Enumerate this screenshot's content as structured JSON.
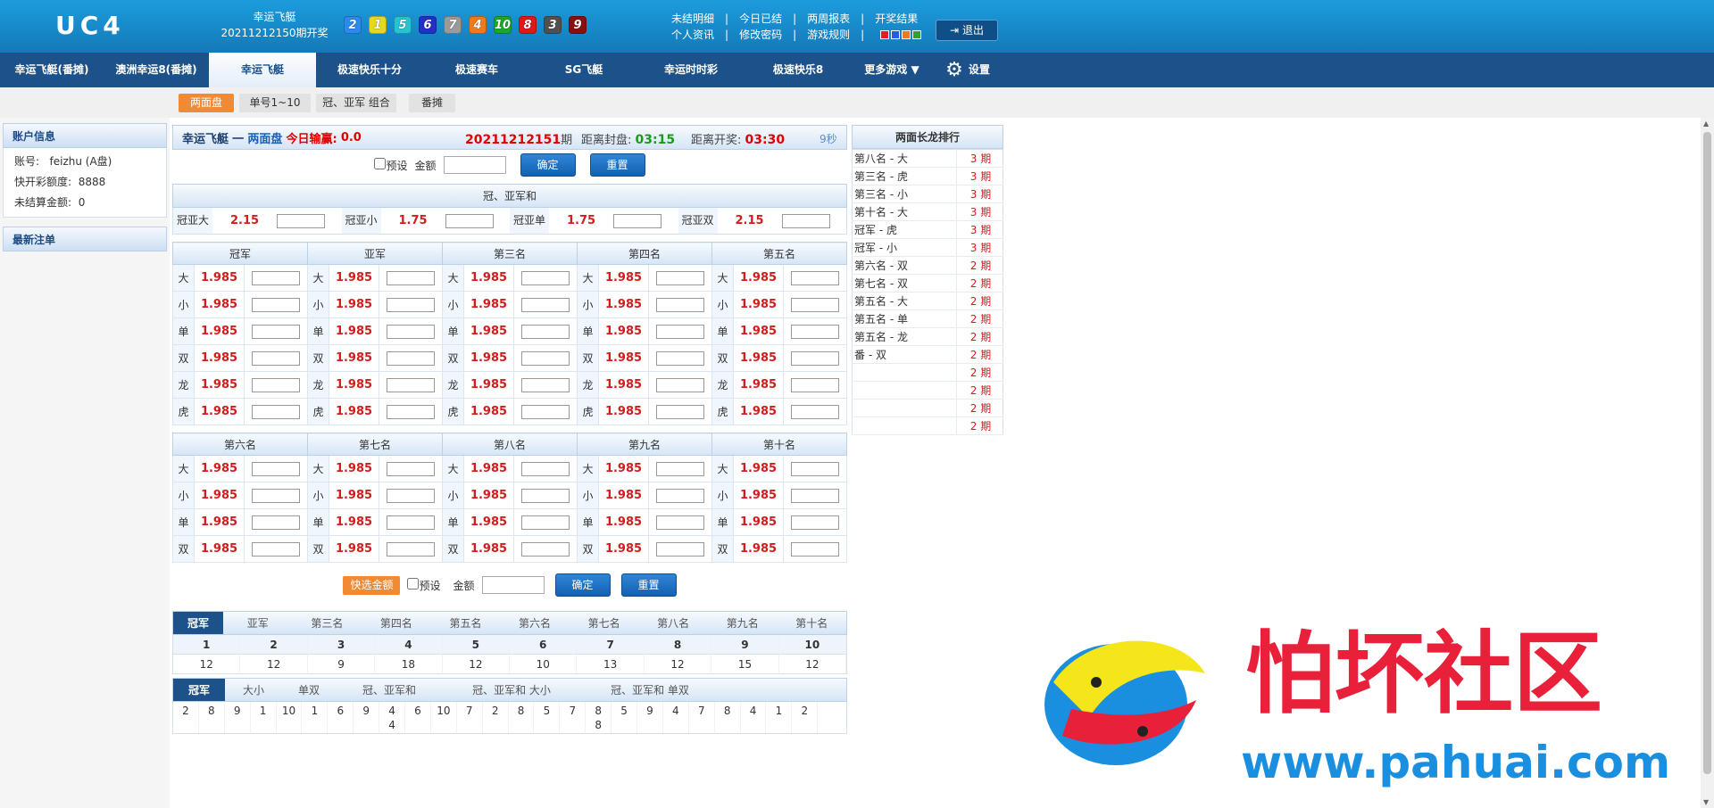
{
  "header": {
    "logo": "UC4",
    "game_name": "幸运飞艇",
    "draw_period": "20211212150期开奖",
    "balls": [
      {
        "n": "2",
        "color": "#2b8af0"
      },
      {
        "n": "1",
        "color": "#e6d820"
      },
      {
        "n": "5",
        "color": "#26c4d2"
      },
      {
        "n": "6",
        "color": "#2030c8"
      },
      {
        "n": "7",
        "color": "#9a9a9a"
      },
      {
        "n": "4",
        "color": "#f07a1a"
      },
      {
        "n": "10",
        "color": "#1aa82a"
      },
      {
        "n": "8",
        "color": "#e01818"
      },
      {
        "n": "3",
        "color": "#505050"
      },
      {
        "n": "9",
        "color": "#8a1010"
      }
    ],
    "links_row1": [
      "未结明细",
      "今日已结",
      "两周报表",
      "开奖结果"
    ],
    "links_row2": [
      "个人资讯",
      "修改密码",
      "游戏规则"
    ],
    "swatches": [
      "#e02020",
      "#2060e0",
      "#f07a1a",
      "#30a030"
    ],
    "logout": "退出"
  },
  "nav": {
    "items": [
      "幸运飞艇(番摊)",
      "澳洲幸运8(番摊)",
      "幸运飞艇",
      "极速快乐十分",
      "极速赛车",
      "SG飞艇",
      "幸运时时彩",
      "极速快乐8",
      "更多游戏 ▼"
    ],
    "settings": "设置"
  },
  "subnav": [
    "两面盘",
    "单号1~10",
    "冠、亚军 组合",
    "番摊"
  ],
  "account": {
    "title": "账户信息",
    "account_label": "账号:",
    "account_value": "feizhu (A盘)",
    "credit_label": "快开彩额度:",
    "credit_value": "8888",
    "unsettled_label": "未结算金额:",
    "unsettled_value": "0",
    "recent_title": "最新注单"
  },
  "titlebar": {
    "game": "幸运飞艇",
    "dash": "一",
    "mode": "两面盘",
    "today_label": "今日输赢:",
    "today_value": "0.0",
    "period": "20211212151",
    "period_suffix": "期",
    "close_label": "距离封盘:",
    "close_time": "03:15",
    "draw_label": "距离开奖:",
    "draw_time": "03:30",
    "refresh": "9秒"
  },
  "betbar": {
    "preset": "预设",
    "amount": "金额",
    "confirm": "确定",
    "reset": "重置",
    "quick": "快选金额"
  },
  "gyh": {
    "title": "冠、亚军和",
    "items": [
      {
        "label": "冠亚大",
        "odds": "2.15"
      },
      {
        "label": "冠亚小",
        "odds": "1.75"
      },
      {
        "label": "冠亚单",
        "odds": "1.75"
      },
      {
        "label": "冠亚双",
        "odds": "2.15"
      }
    ]
  },
  "grid1": {
    "headers": [
      "冠军",
      "亚军",
      "第三名",
      "第四名",
      "第五名"
    ],
    "rows": [
      "大",
      "小",
      "单",
      "双",
      "龙",
      "虎"
    ],
    "odds": "1.985"
  },
  "grid2": {
    "headers": [
      "第六名",
      "第七名",
      "第八名",
      "第九名",
      "第十名"
    ],
    "rows": [
      "大",
      "小",
      "单",
      "双"
    ],
    "odds": "1.985"
  },
  "stats": {
    "tabs": [
      "冠军",
      "亚军",
      "第三名",
      "第四名",
      "第五名",
      "第六名",
      "第七名",
      "第八名",
      "第九名",
      "第十名"
    ],
    "numbers": [
      "1",
      "2",
      "3",
      "4",
      "5",
      "6",
      "7",
      "8",
      "9",
      "10"
    ],
    "counts": [
      "12",
      "12",
      "9",
      "18",
      "12",
      "10",
      "13",
      "12",
      "15",
      "12"
    ]
  },
  "trend": {
    "tabs": [
      "冠军",
      "大小",
      "单双",
      "冠、亚军和",
      "冠、亚军和 大小",
      "冠、亚军和 单双"
    ],
    "values": [
      [
        "2"
      ],
      [
        "8"
      ],
      [
        "9"
      ],
      [
        "1"
      ],
      [
        "10"
      ],
      [
        "1"
      ],
      [
        "6"
      ],
      [
        "9"
      ],
      [
        "4",
        "4"
      ],
      [
        "6"
      ],
      [
        "10"
      ],
      [
        "7"
      ],
      [
        "2"
      ],
      [
        "8"
      ],
      [
        "5"
      ],
      [
        "7"
      ],
      [
        "8",
        "8"
      ],
      [
        "5"
      ],
      [
        "9"
      ],
      [
        "4"
      ],
      [
        "7"
      ],
      [
        "8"
      ],
      [
        "4"
      ],
      [
        "1"
      ],
      [
        "2"
      ]
    ]
  },
  "ranking": {
    "title": "两面长龙排行",
    "rows": [
      {
        "name": "第八名 - 大",
        "count": "3 期"
      },
      {
        "name": "第三名 - 虎",
        "count": "3 期"
      },
      {
        "name": "第三名 - 小",
        "count": "3 期"
      },
      {
        "name": "第十名 - 大",
        "count": "3 期"
      },
      {
        "name": "冠军 - 虎",
        "count": "3 期"
      },
      {
        "name": "冠军 - 小",
        "count": "3 期"
      },
      {
        "name": "第六名 - 双",
        "count": "2 期"
      },
      {
        "name": "第七名 - 双",
        "count": "2 期"
      },
      {
        "name": "第五名 - 大",
        "count": "2 期"
      },
      {
        "name": "第五名 - 单",
        "count": "2 期"
      },
      {
        "name": "第五名 - 龙",
        "count": "2 期"
      },
      {
        "name": "番 - 双",
        "count": "2 期"
      },
      {
        "name": "",
        "count": "2 期"
      },
      {
        "name": "",
        "count": "2 期"
      },
      {
        "name": "",
        "count": "2 期"
      },
      {
        "name": "",
        "count": "2 期"
      }
    ]
  },
  "watermark": {
    "name": "怕坏社区",
    "url": "www.pahuai.com"
  }
}
